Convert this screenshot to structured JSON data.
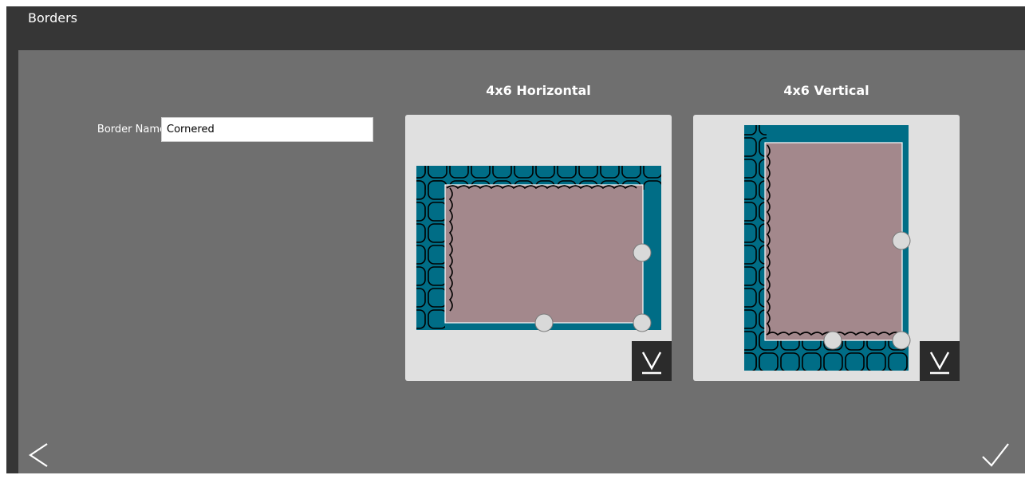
{
  "window": {
    "title": "Borders"
  },
  "form": {
    "border_name_label": "Border Name",
    "border_name_value": "Cornered"
  },
  "cards": [
    {
      "title": "4x6 Horizontal"
    },
    {
      "title": "4x6 Vertical"
    }
  ],
  "colors": {
    "title_bar": "#363636",
    "content_bg": "#6f6f6f",
    "card_bg": "#e0e0e0",
    "border_teal": "#006d86",
    "photo_area": "#a3888c"
  },
  "icons": {
    "download": "download-icon",
    "back": "chevron-left-icon",
    "confirm": "checkmark-icon"
  }
}
